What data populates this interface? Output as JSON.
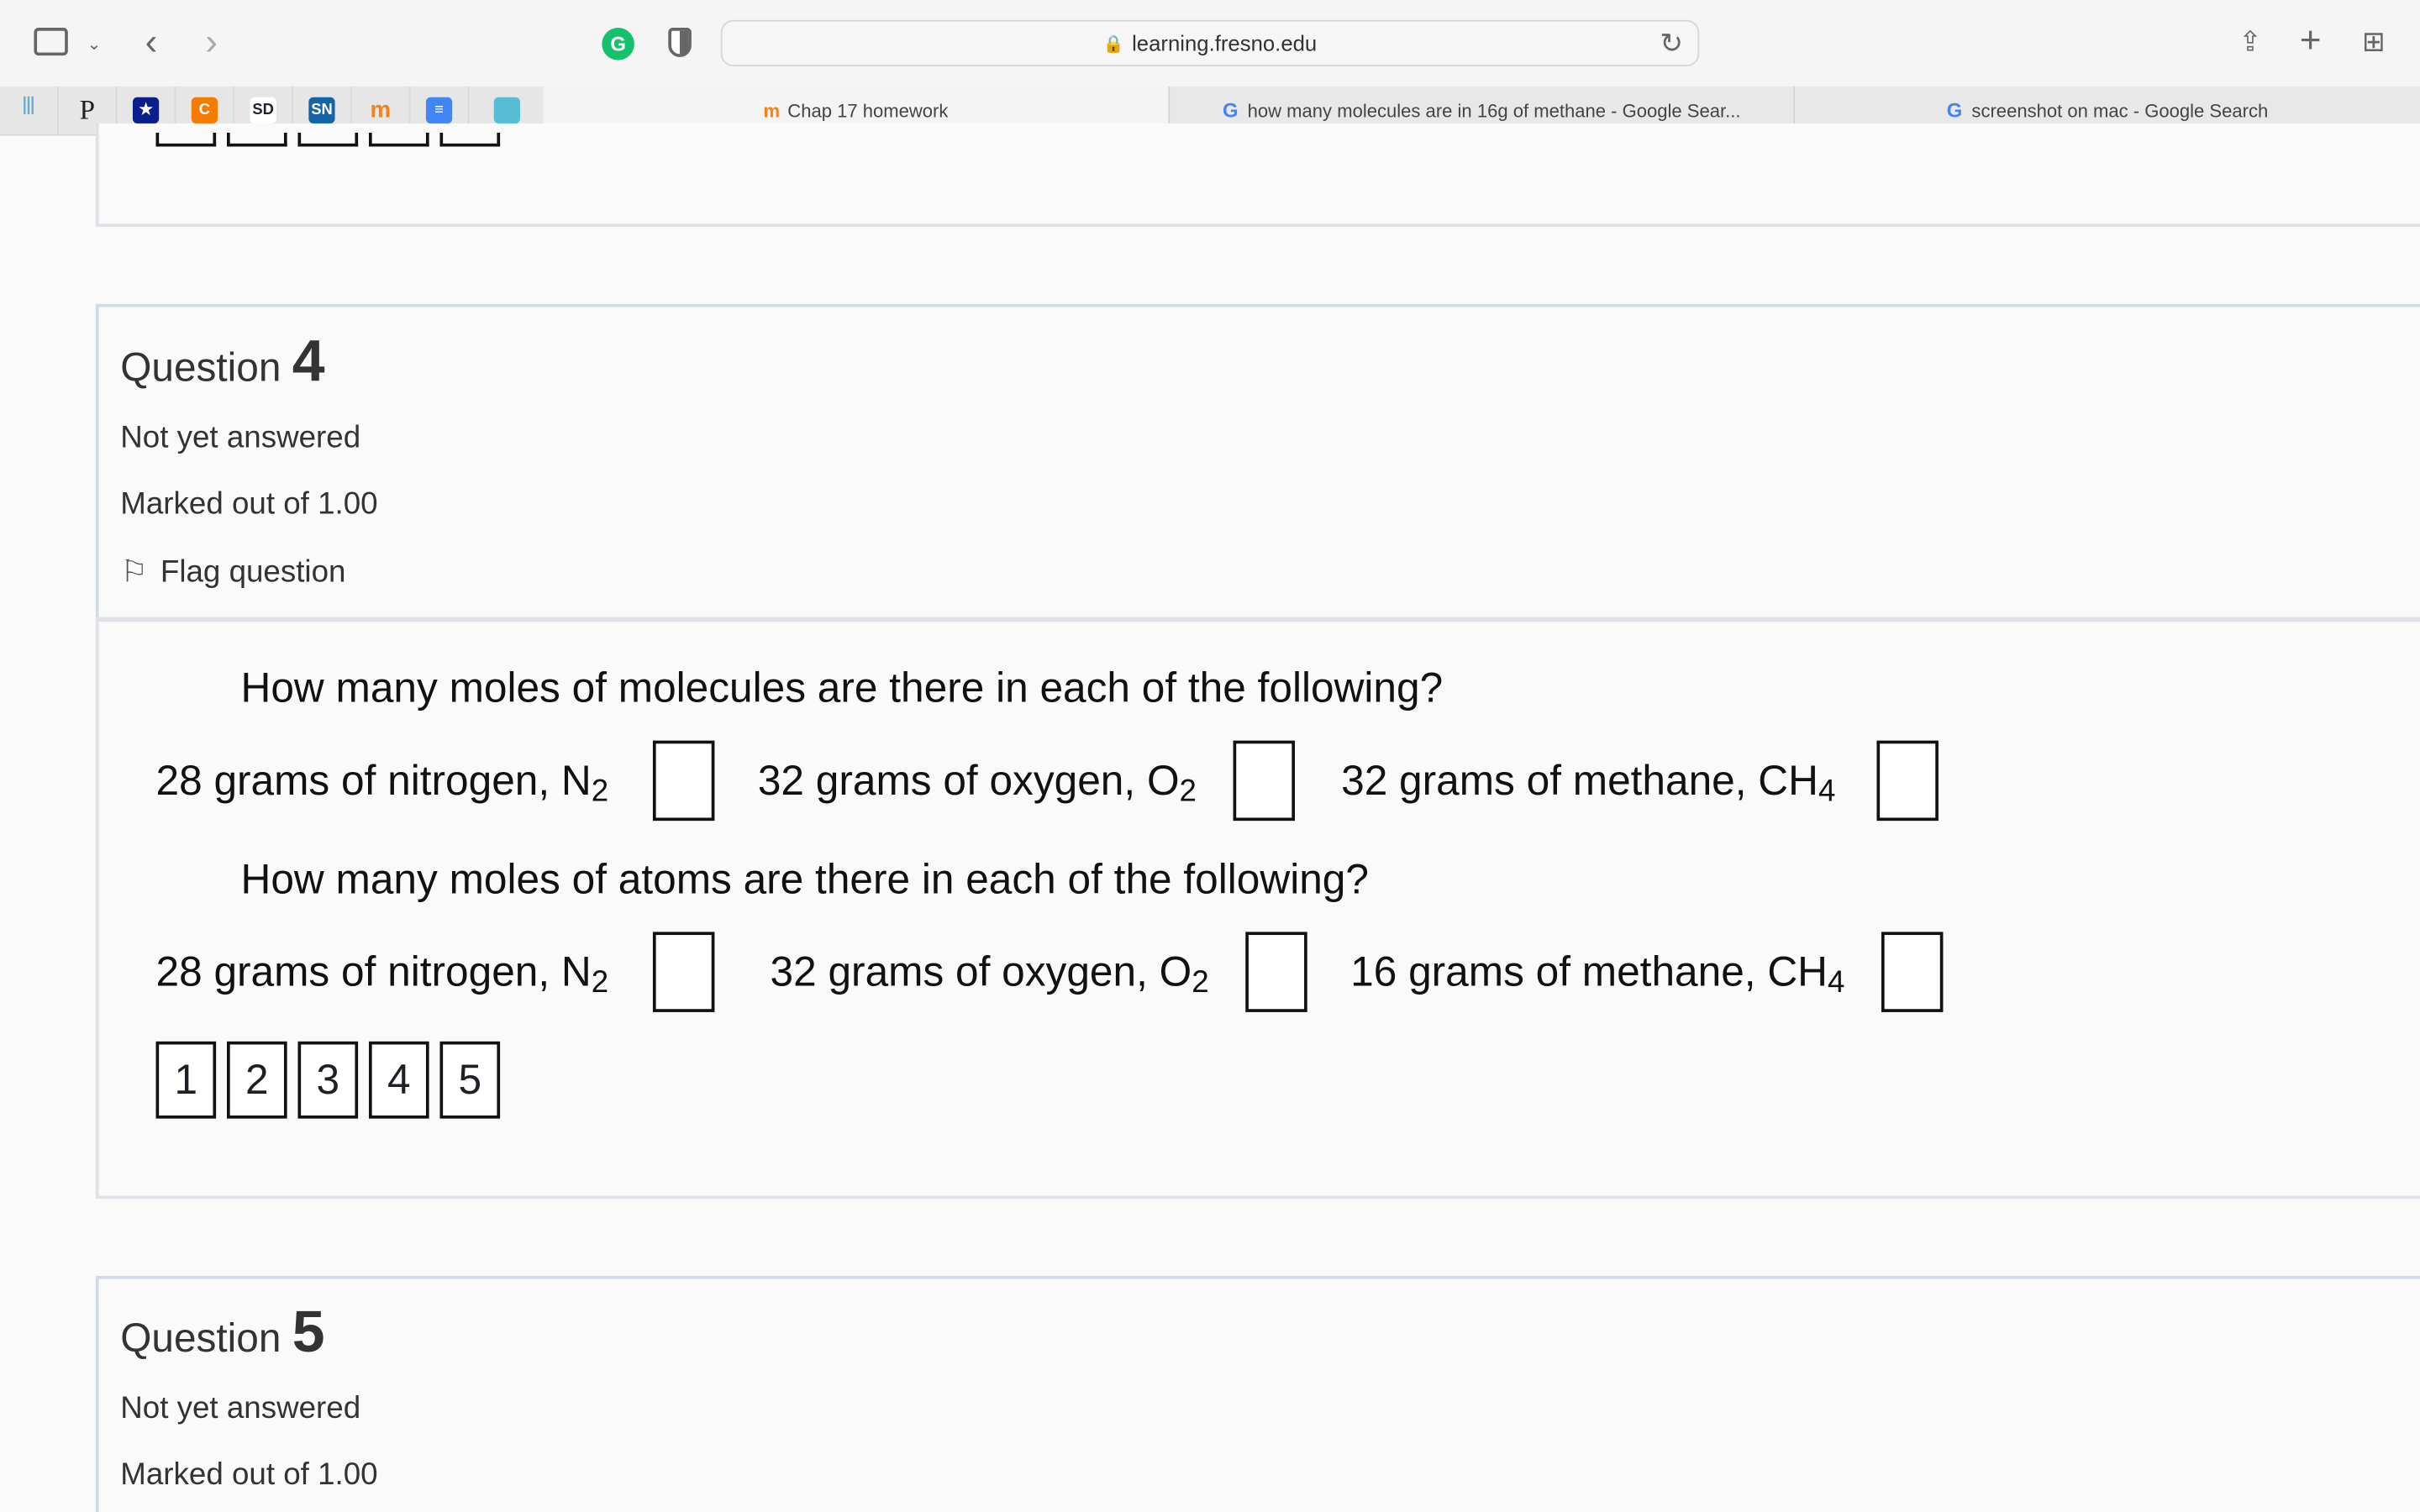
{
  "browser": {
    "url": "learning.fresno.edu",
    "tabs": [
      {
        "label": "Chap 17 homework",
        "active": true
      },
      {
        "label": "how many molecules are in 16g of methane - Google Sear..."
      },
      {
        "label": "screenshot on mac - Google Search"
      }
    ],
    "bookmarks": [
      "library",
      "P",
      "star-shield",
      "C",
      "SD",
      "SN",
      "moodle",
      "docs",
      "blue-square"
    ]
  },
  "questions": [
    {
      "label": "Question",
      "number": "4",
      "status": "Not yet answered",
      "marks": "Marked out of 1.00",
      "flag": "Flag question",
      "prompt1": "How many moles of molecules are there in each of the following?",
      "row1": [
        {
          "text": "28 grams of nitrogen, N",
          "sub": "2"
        },
        {
          "text": "32 grams of oxygen, O",
          "sub": "2"
        },
        {
          "text": "32 grams of methane, CH",
          "sub": "4"
        }
      ],
      "prompt2": "How many moles of atoms are there in each of the following?",
      "row2": [
        {
          "text": "28 grams of nitrogen, N",
          "sub": "2"
        },
        {
          "text": "32 grams of oxygen, O",
          "sub": "2"
        },
        {
          "text": "16 grams of methane, CH",
          "sub": "4"
        }
      ],
      "choices": [
        "1",
        "2",
        "3",
        "4",
        "5"
      ]
    },
    {
      "label": "Question",
      "number": "5",
      "status": "Not yet answered",
      "marks": "Marked out of 1.00"
    }
  ],
  "colors": {
    "grammarly": "#15c26b",
    "border": "#dee2e6"
  }
}
